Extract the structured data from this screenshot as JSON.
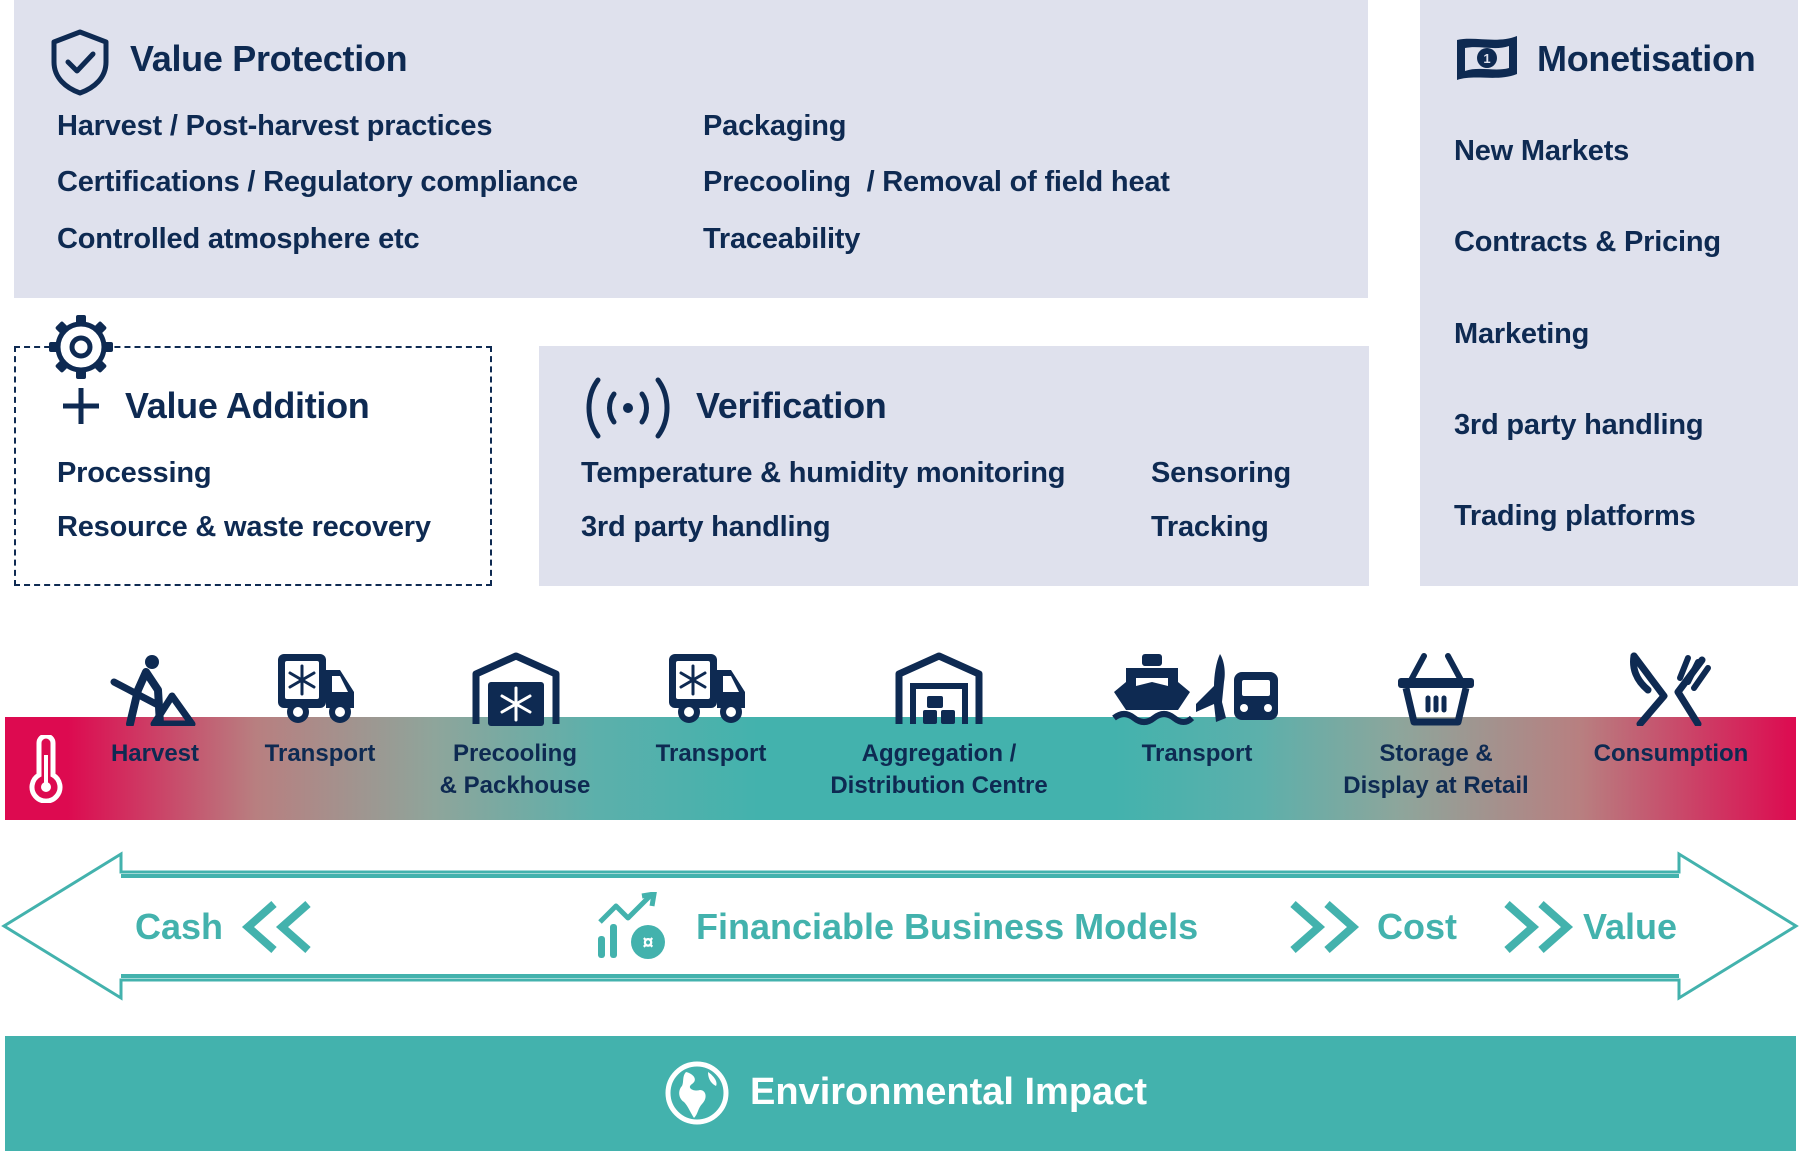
{
  "value_protection": {
    "title": "Value Protection",
    "icon": "shield-check-icon",
    "items_left": [
      "Harvest / Post-harvest practices",
      "Certifications / Regulatory compliance",
      "Controlled atmosphere etc"
    ],
    "items_right": [
      "Packaging",
      "Precooling  / Removal of field heat",
      "Traceability"
    ]
  },
  "monetisation": {
    "title": "Monetisation",
    "icon": "banknote-icon",
    "items": [
      "New Markets",
      "Contracts & Pricing",
      "Marketing",
      "3rd party handling",
      "Trading platforms"
    ]
  },
  "value_addition": {
    "title": "Value Addition",
    "icon": "gear-plus-icon",
    "items": [
      "Processing",
      "Resource & waste recovery"
    ]
  },
  "verification": {
    "title": "Verification",
    "icon": "broadcast-signal-icon",
    "items_left": [
      "Temperature & humidity monitoring",
      "3rd party handling"
    ],
    "items_right": [
      "Sensoring",
      "Tracking"
    ]
  },
  "cold_chain": {
    "thermometer_icon": "thermometer-icon",
    "colors": {
      "hot": "#dd0a50",
      "cool": "#43b2ad"
    },
    "stages": [
      {
        "label": "Harvest",
        "icon": "harvest-worker-icon"
      },
      {
        "label": "Transport",
        "icon": "refrigerated-truck-icon"
      },
      {
        "label": "Precooling\n& Packhouse",
        "icon": "cold-storage-shed-icon"
      },
      {
        "label": "Transport",
        "icon": "refrigerated-truck-icon"
      },
      {
        "label": "Aggregation /\nDistribution Centre",
        "icon": "warehouse-icon"
      },
      {
        "label": "Transport",
        "icon": "ship-plane-truck-icon"
      },
      {
        "label": "Storage &\nDisplay at Retail",
        "icon": "shopping-basket-icon"
      },
      {
        "label": "Consumption",
        "icon": "knife-fork-icon"
      }
    ]
  },
  "financiable": {
    "left": "Cash",
    "center": "Financiable Business Models",
    "cost": "Cost",
    "value": "Value",
    "icon": "growth-chart-coin-icon",
    "color": "#43b2ad"
  },
  "environmental": {
    "label": "Environmental Impact",
    "icon": "globe-icon",
    "color": "#43b2ad"
  }
}
